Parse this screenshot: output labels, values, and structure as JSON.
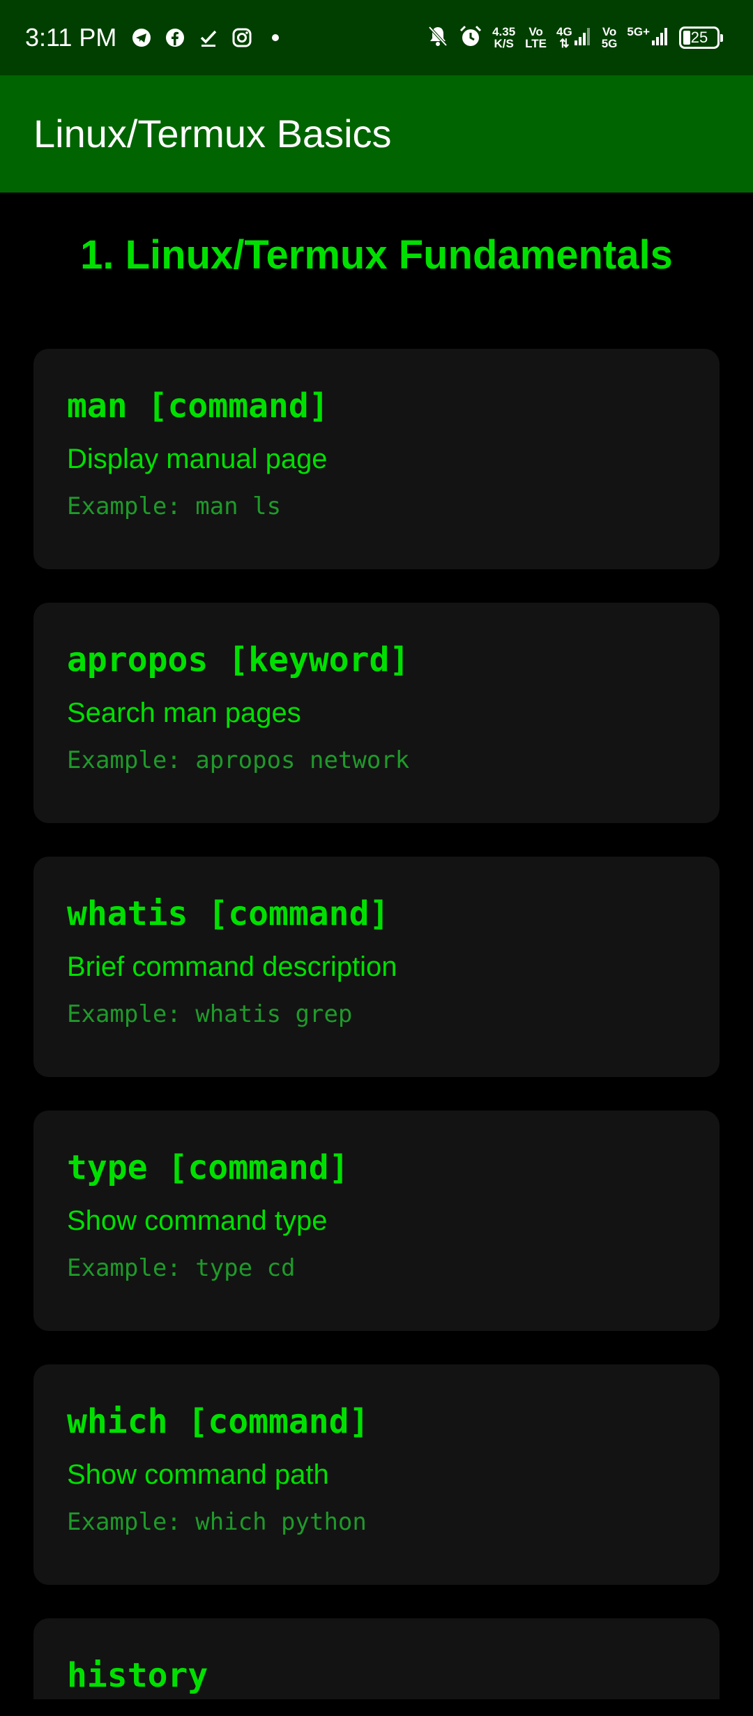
{
  "status_bar": {
    "time": "3:11 PM",
    "left_icons": [
      "telegram-icon",
      "facebook-icon",
      "download-done-icon",
      "instagram-icon",
      "dot-icon"
    ],
    "net_speed_value": "4.35",
    "net_speed_unit": "K/S",
    "volte_top": "Vo",
    "volte_bottom": "LTE",
    "network_4g": "4G",
    "vo5g_top": "Vo",
    "vo5g_bottom": "5G",
    "network_5g": "5G+",
    "battery_level": "25"
  },
  "app_bar": {
    "title": "Linux/Termux Basics",
    "color": "#006400"
  },
  "section": {
    "heading": "1. Linux/Termux Fundamentals"
  },
  "colors": {
    "accent": "#00e000",
    "example": "#1f9a2a",
    "card_bg": "#131313",
    "background": "#000000",
    "status_bar_bg": "#003f00"
  },
  "commands": [
    {
      "command": "man [command]",
      "description": "Display manual page",
      "example": "Example: man ls"
    },
    {
      "command": "apropos [keyword]",
      "description": "Search man pages",
      "example": "Example: apropos network"
    },
    {
      "command": "whatis [command]",
      "description": "Brief command description",
      "example": "Example: whatis grep"
    },
    {
      "command": "type [command]",
      "description": "Show command type",
      "example": "Example: type cd"
    },
    {
      "command": "which [command]",
      "description": "Show command path",
      "example": "Example: which python"
    },
    {
      "command": "history"
    }
  ]
}
